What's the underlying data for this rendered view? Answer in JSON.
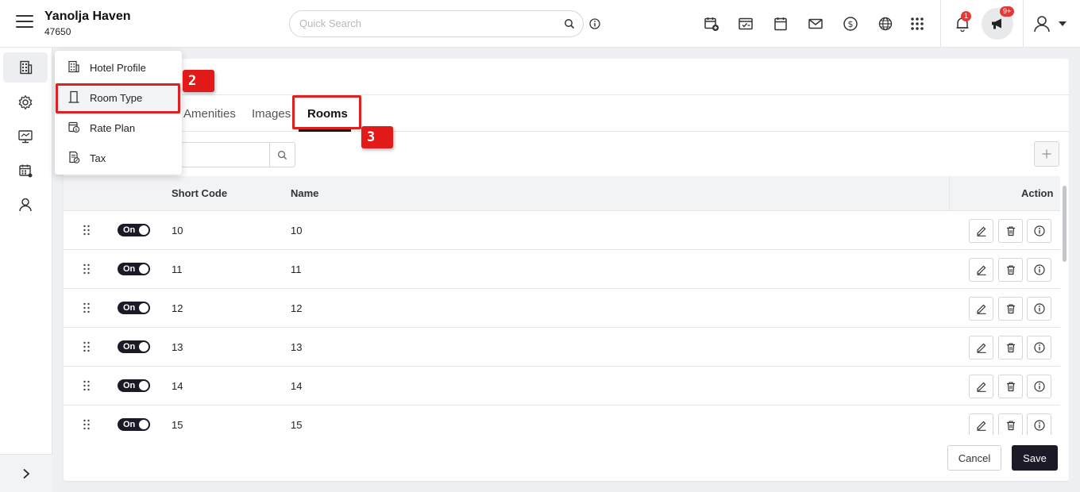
{
  "header": {
    "hotel_name": "Yanolja Haven",
    "hotel_id": "47650",
    "search_placeholder": "Quick Search",
    "notification_count": "1",
    "announcement_count": "9+"
  },
  "menu": {
    "items": [
      {
        "label": "Hotel Profile",
        "icon": "building-icon"
      },
      {
        "label": "Room Type",
        "icon": "door-icon"
      },
      {
        "label": "Rate Plan",
        "icon": "rate-plan-icon"
      },
      {
        "label": "Tax",
        "icon": "tax-icon"
      }
    ]
  },
  "tabs": {
    "amenities": "Amenities",
    "images": "Images",
    "rooms": "Rooms"
  },
  "table": {
    "columns": {
      "short_code": "Short Code",
      "name": "Name",
      "action": "Action"
    },
    "rows": [
      {
        "status": "On",
        "short_code": "10",
        "name": "10"
      },
      {
        "status": "On",
        "short_code": "11",
        "name": "11"
      },
      {
        "status": "On",
        "short_code": "12",
        "name": "12"
      },
      {
        "status": "On",
        "short_code": "13",
        "name": "13"
      },
      {
        "status": "On",
        "short_code": "14",
        "name": "14"
      },
      {
        "status": "On",
        "short_code": "15",
        "name": "15"
      }
    ]
  },
  "footer": {
    "cancel_label": "Cancel",
    "save_label": "Save"
  },
  "annotations": {
    "step_2": "2",
    "step_3": "3"
  },
  "colors": {
    "accent": "#1b1a26",
    "annotation": "#e21a1a",
    "badge": "#e53935"
  }
}
